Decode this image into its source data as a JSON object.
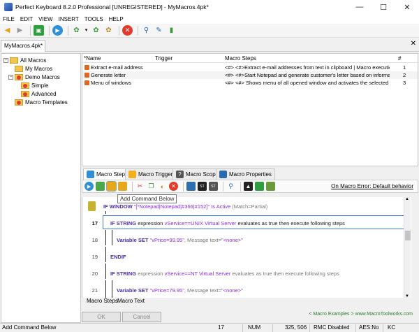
{
  "window": {
    "title": "Perfect Keyboard 8.2.0 Professional [UNREGISTERED] - MyMacros.4pk*",
    "minimize": "—",
    "maximize": "☐",
    "close": "✕"
  },
  "menu": [
    "FILE",
    "EDIT",
    "VIEW",
    "INSERT",
    "TOOLS",
    "HELP"
  ],
  "doc_tab": {
    "label": "MyMacros.4pk*",
    "close": "✕"
  },
  "tree": {
    "items": [
      {
        "label": "All Macros"
      },
      {
        "label": "My Macros"
      },
      {
        "label": "Demo Macros"
      },
      {
        "label": "Simple"
      },
      {
        "label": "Advanced"
      },
      {
        "label": "Macro Templates"
      }
    ],
    "expand": "−"
  },
  "macro_list": {
    "columns": [
      "*Name",
      "Trigger",
      "Macro Steps",
      "#"
    ],
    "rows": [
      {
        "name": "Extract e-mail address",
        "trigger": "",
        "steps": "<#> <#>Extract e-mail addresses from text in clipboard | Macro execution: O...",
        "num": "1"
      },
      {
        "name": "Generate letter",
        "trigger": "",
        "steps": "<#> <#>Start Notepad and generate customer's letter based on information e...",
        "num": "2"
      },
      {
        "name": "Menu of windows",
        "trigger": "",
        "steps": "<#> <#> Shows menu of all opened window and activates the selected one |...",
        "num": "3"
      }
    ]
  },
  "panel_tabs": [
    "Macro Steps",
    "Macro Triggers",
    "Macro Scope",
    "Macro Properties"
  ],
  "on_error": "On Macro Error: Default behavior",
  "tooltip": "Add Command Below",
  "code": {
    "line0": {
      "kw": "IF WINDOW",
      "str": "\"[*Notepad|Notepad|#366|#152]\"",
      "rest": "Is Active",
      "paren": "(Match=Partial)"
    },
    "line17": {
      "num": "17",
      "kw": "IF STRING",
      "text": "expression",
      "var": "vService==UNIX Virtual Server",
      "rest": "evaluates as true then execute following steps"
    },
    "line18": {
      "num": "18",
      "kw": "Variable SET",
      "str": "\"vPrice=99.95\"",
      "rest": ", Message text=",
      "val": "\"<none>\""
    },
    "line19": {
      "num": "19",
      "kw": "ENDIF"
    },
    "line20": {
      "num": "20",
      "kw": "IF STRING",
      "text": "expression",
      "var": "vService==NT Virtual Server",
      "rest": "evaluates as true then execute following steps"
    },
    "line21": {
      "num": "21",
      "kw": "Variable SET",
      "str": "\"vPrice=79.95\"",
      "rest": ", Message text=",
      "val": "\"<none>\""
    }
  },
  "bottom_tabs": [
    "Macro Steps",
    "Macro Text"
  ],
  "buttons": {
    "ok": "OK",
    "cancel": "Cancel"
  },
  "footer_link": "< Macro Examples >  www.MacroToolworks.com",
  "status": {
    "message": "Add Command Below",
    "line": "17",
    "num": "NUM",
    "coords": "325, 506",
    "rmc": "RMC Disabled",
    "aes": "AES:No",
    "kc": "KC"
  },
  "colors": {
    "accent": "#3d7bd9",
    "keyword": "#4a2fa8",
    "string": "#8a2be2"
  }
}
